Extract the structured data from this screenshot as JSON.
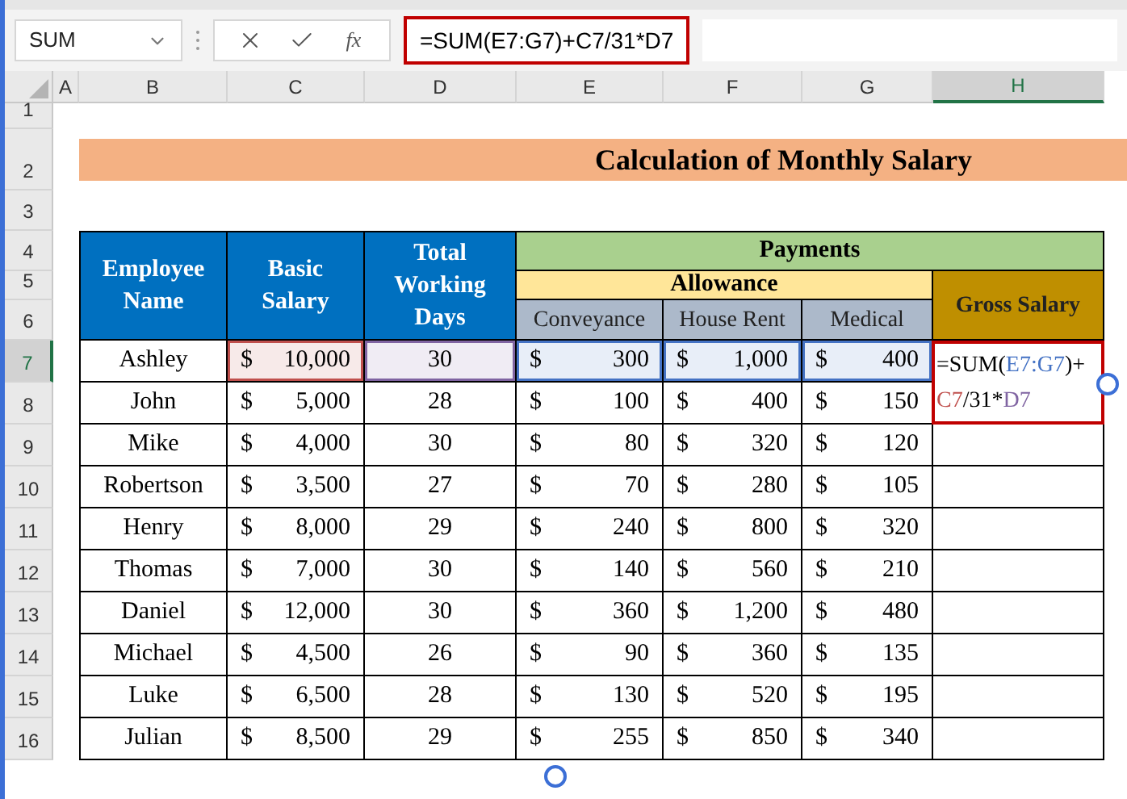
{
  "name_box": {
    "value": "SUM"
  },
  "formula_bar": {
    "buttons": [
      {
        "kind": "cancel"
      },
      {
        "kind": "enter"
      },
      {
        "kind": "function",
        "label": "fx"
      }
    ],
    "formula": "=SUM(E7:G7)+C7/31*D7"
  },
  "column_headers": [
    {
      "label": "A",
      "selected": false
    },
    {
      "label": "B",
      "selected": false
    },
    {
      "label": "C",
      "selected": false
    },
    {
      "label": "D",
      "selected": false
    },
    {
      "label": "E",
      "selected": false
    },
    {
      "label": "F",
      "selected": false
    },
    {
      "label": "G",
      "selected": false
    },
    {
      "label": "H",
      "selected": true
    }
  ],
  "row_headers": [
    {
      "label": "1",
      "selected": false
    },
    {
      "label": "2",
      "selected": false
    },
    {
      "label": "3",
      "selected": false
    },
    {
      "label": "4",
      "selected": false
    },
    {
      "label": "5",
      "selected": false
    },
    {
      "label": "6",
      "selected": false
    },
    {
      "label": "7",
      "selected": true
    },
    {
      "label": "8",
      "selected": false
    },
    {
      "label": "9",
      "selected": false
    },
    {
      "label": "10",
      "selected": false
    },
    {
      "label": "11",
      "selected": false
    },
    {
      "label": "12",
      "selected": false
    },
    {
      "label": "13",
      "selected": false
    },
    {
      "label": "14",
      "selected": false
    },
    {
      "label": "15",
      "selected": false
    },
    {
      "label": "16",
      "selected": false
    }
  ],
  "title": "Calculation of Monthly Salary",
  "table": {
    "headers": {
      "name": "Employee Name",
      "basic": "Basic Salary",
      "days": "Total Working Days",
      "payments": "Payments",
      "allowance": "Allowance",
      "conveyance": "Conveyance",
      "house_rent": "House Rent",
      "medical": "Medical",
      "gross": "Gross Salary"
    },
    "rows": [
      {
        "name": "Ashley",
        "basic": {
          "symbol": "$",
          "amount": "10,000",
          "color": "#c0504d"
        },
        "days": {
          "value": "30",
          "color": "#8064a2"
        },
        "conveyance": {
          "symbol": "$",
          "amount": "300",
          "color": "#4472c4"
        },
        "house_rent": {
          "symbol": "$",
          "amount": "1,000",
          "color": "#4472c4"
        },
        "medical": {
          "symbol": "$",
          "amount": "400",
          "color": "#4472c4"
        }
      },
      {
        "name": "John",
        "basic": {
          "symbol": "$",
          "amount": "5,000"
        },
        "days": {
          "value": "28"
        },
        "conveyance": {
          "symbol": "$",
          "amount": "100"
        },
        "house_rent": {
          "symbol": "$",
          "amount": "400"
        },
        "medical": {
          "symbol": "$",
          "amount": "150"
        }
      },
      {
        "name": "Mike",
        "basic": {
          "symbol": "$",
          "amount": "4,000"
        },
        "days": {
          "value": "30"
        },
        "conveyance": {
          "symbol": "$",
          "amount": "80"
        },
        "house_rent": {
          "symbol": "$",
          "amount": "320"
        },
        "medical": {
          "symbol": "$",
          "amount": "120"
        }
      },
      {
        "name": "Robertson",
        "basic": {
          "symbol": "$",
          "amount": "3,500"
        },
        "days": {
          "value": "27"
        },
        "conveyance": {
          "symbol": "$",
          "amount": "70"
        },
        "house_rent": {
          "symbol": "$",
          "amount": "280"
        },
        "medical": {
          "symbol": "$",
          "amount": "105"
        }
      },
      {
        "name": "Henry",
        "basic": {
          "symbol": "$",
          "amount": "8,000"
        },
        "days": {
          "value": "29"
        },
        "conveyance": {
          "symbol": "$",
          "amount": "240"
        },
        "house_rent": {
          "symbol": "$",
          "amount": "800"
        },
        "medical": {
          "symbol": "$",
          "amount": "320"
        }
      },
      {
        "name": "Thomas",
        "basic": {
          "symbol": "$",
          "amount": "7,000"
        },
        "days": {
          "value": "30"
        },
        "conveyance": {
          "symbol": "$",
          "amount": "140"
        },
        "house_rent": {
          "symbol": "$",
          "amount": "560"
        },
        "medical": {
          "symbol": "$",
          "amount": "210"
        }
      },
      {
        "name": "Daniel",
        "basic": {
          "symbol": "$",
          "amount": "12,000"
        },
        "days": {
          "value": "30"
        },
        "conveyance": {
          "symbol": "$",
          "amount": "360"
        },
        "house_rent": {
          "symbol": "$",
          "amount": "1,200"
        },
        "medical": {
          "symbol": "$",
          "amount": "480"
        }
      },
      {
        "name": "Michael",
        "basic": {
          "symbol": "$",
          "amount": "4,500"
        },
        "days": {
          "value": "26"
        },
        "conveyance": {
          "symbol": "$",
          "amount": "90"
        },
        "house_rent": {
          "symbol": "$",
          "amount": "360"
        },
        "medical": {
          "symbol": "$",
          "amount": "135"
        }
      },
      {
        "name": "Luke",
        "basic": {
          "symbol": "$",
          "amount": "6,500"
        },
        "days": {
          "value": "28"
        },
        "conveyance": {
          "symbol": "$",
          "amount": "130"
        },
        "house_rent": {
          "symbol": "$",
          "amount": "520"
        },
        "medical": {
          "symbol": "$",
          "amount": "195"
        }
      },
      {
        "name": "Julian",
        "basic": {
          "symbol": "$",
          "amount": "8,500"
        },
        "days": {
          "value": "29"
        },
        "conveyance": {
          "symbol": "$",
          "amount": "255"
        },
        "house_rent": {
          "symbol": "$",
          "amount": "850"
        },
        "medical": {
          "symbol": "$",
          "amount": "340"
        }
      }
    ]
  },
  "editing_cell": {
    "parts": [
      {
        "text": "=SUM(",
        "color": "#000000"
      },
      {
        "text": "E7:G7",
        "color": "#4472c4"
      },
      {
        "text": ")+",
        "color": "#000000"
      },
      {
        "text": "C7",
        "color": "#c0504d"
      },
      {
        "text": "/31*",
        "color": "#000000"
      },
      {
        "text": "D7",
        "color": "#8064a2"
      }
    ]
  }
}
